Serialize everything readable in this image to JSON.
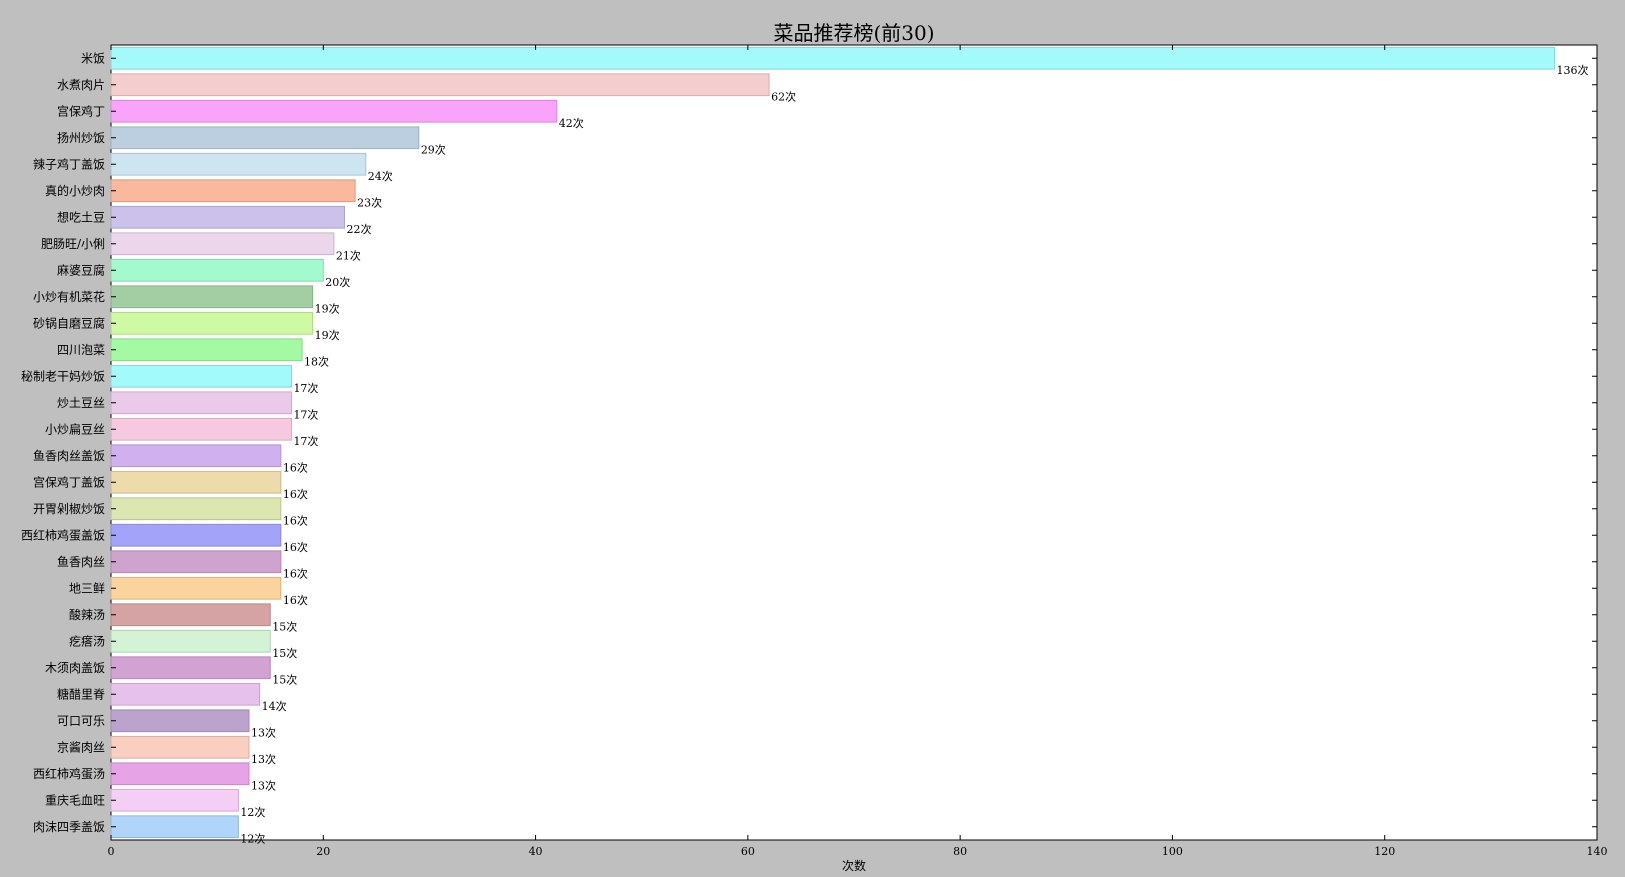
{
  "chart_data": {
    "type": "bar",
    "orientation": "horizontal",
    "title": "菜品推荐榜(前30)",
    "xlabel": "次数",
    "ylabel": "",
    "xlim": [
      0,
      140
    ],
    "xticks": [
      0,
      20,
      40,
      60,
      80,
      100,
      120,
      140
    ],
    "value_suffix": "次",
    "grid": false,
    "categories": [
      "米饭",
      "水煮肉片",
      "宫保鸡丁",
      "扬州炒饭",
      "辣子鸡丁盖饭",
      "真的小炒肉",
      "想吃土豆",
      "肥肠旺/小俐",
      "麻婆豆腐",
      "小炒有机菜花",
      "砂锅自磨豆腐",
      "四川泡菜",
      "秘制老干妈炒饭",
      "炒土豆丝",
      "小炒扁豆丝",
      "鱼香肉丝盖饭",
      "宫保鸡丁盖饭",
      "开胃剁椒炒饭",
      "西红柿鸡蛋盖饭",
      "鱼香肉丝",
      "地三鲜",
      "酸辣汤",
      "疙瘩汤",
      "木须肉盖饭",
      "糖醋里脊",
      "可口可乐",
      "京酱肉丝",
      "西红柿鸡蛋汤",
      "重庆毛血旺",
      "肉沫四季盖饭"
    ],
    "values": [
      136,
      62,
      42,
      29,
      24,
      23,
      22,
      21,
      20,
      19,
      19,
      18,
      17,
      17,
      17,
      16,
      16,
      16,
      16,
      16,
      16,
      15,
      15,
      15,
      14,
      13,
      13,
      13,
      12,
      12
    ],
    "colors": [
      "#a6ffff",
      "#f9d2d2",
      "#ffa6ff",
      "#bfd3e6",
      "#d1eaf5",
      "#ffbca0",
      "#cfc5ef",
      "#f0daf0",
      "#a6ffd2",
      "#a6d2a6",
      "#d2ffa6",
      "#a6ffa6",
      "#a6ffff",
      "#f0cdf0",
      "#fccde6",
      "#d5b4f5",
      "#f2dfae",
      "#e0ebb4",
      "#a6a6ff",
      "#d2a6d2",
      "#ffd7a0",
      "#d9a6a6",
      "#d8f7d8",
      "#d6a6d6",
      "#ebc5f0",
      "#c0a6d2",
      "#ffd2c5",
      "#eba6eb",
      "#fad2fa",
      "#b3d9ff"
    ]
  }
}
